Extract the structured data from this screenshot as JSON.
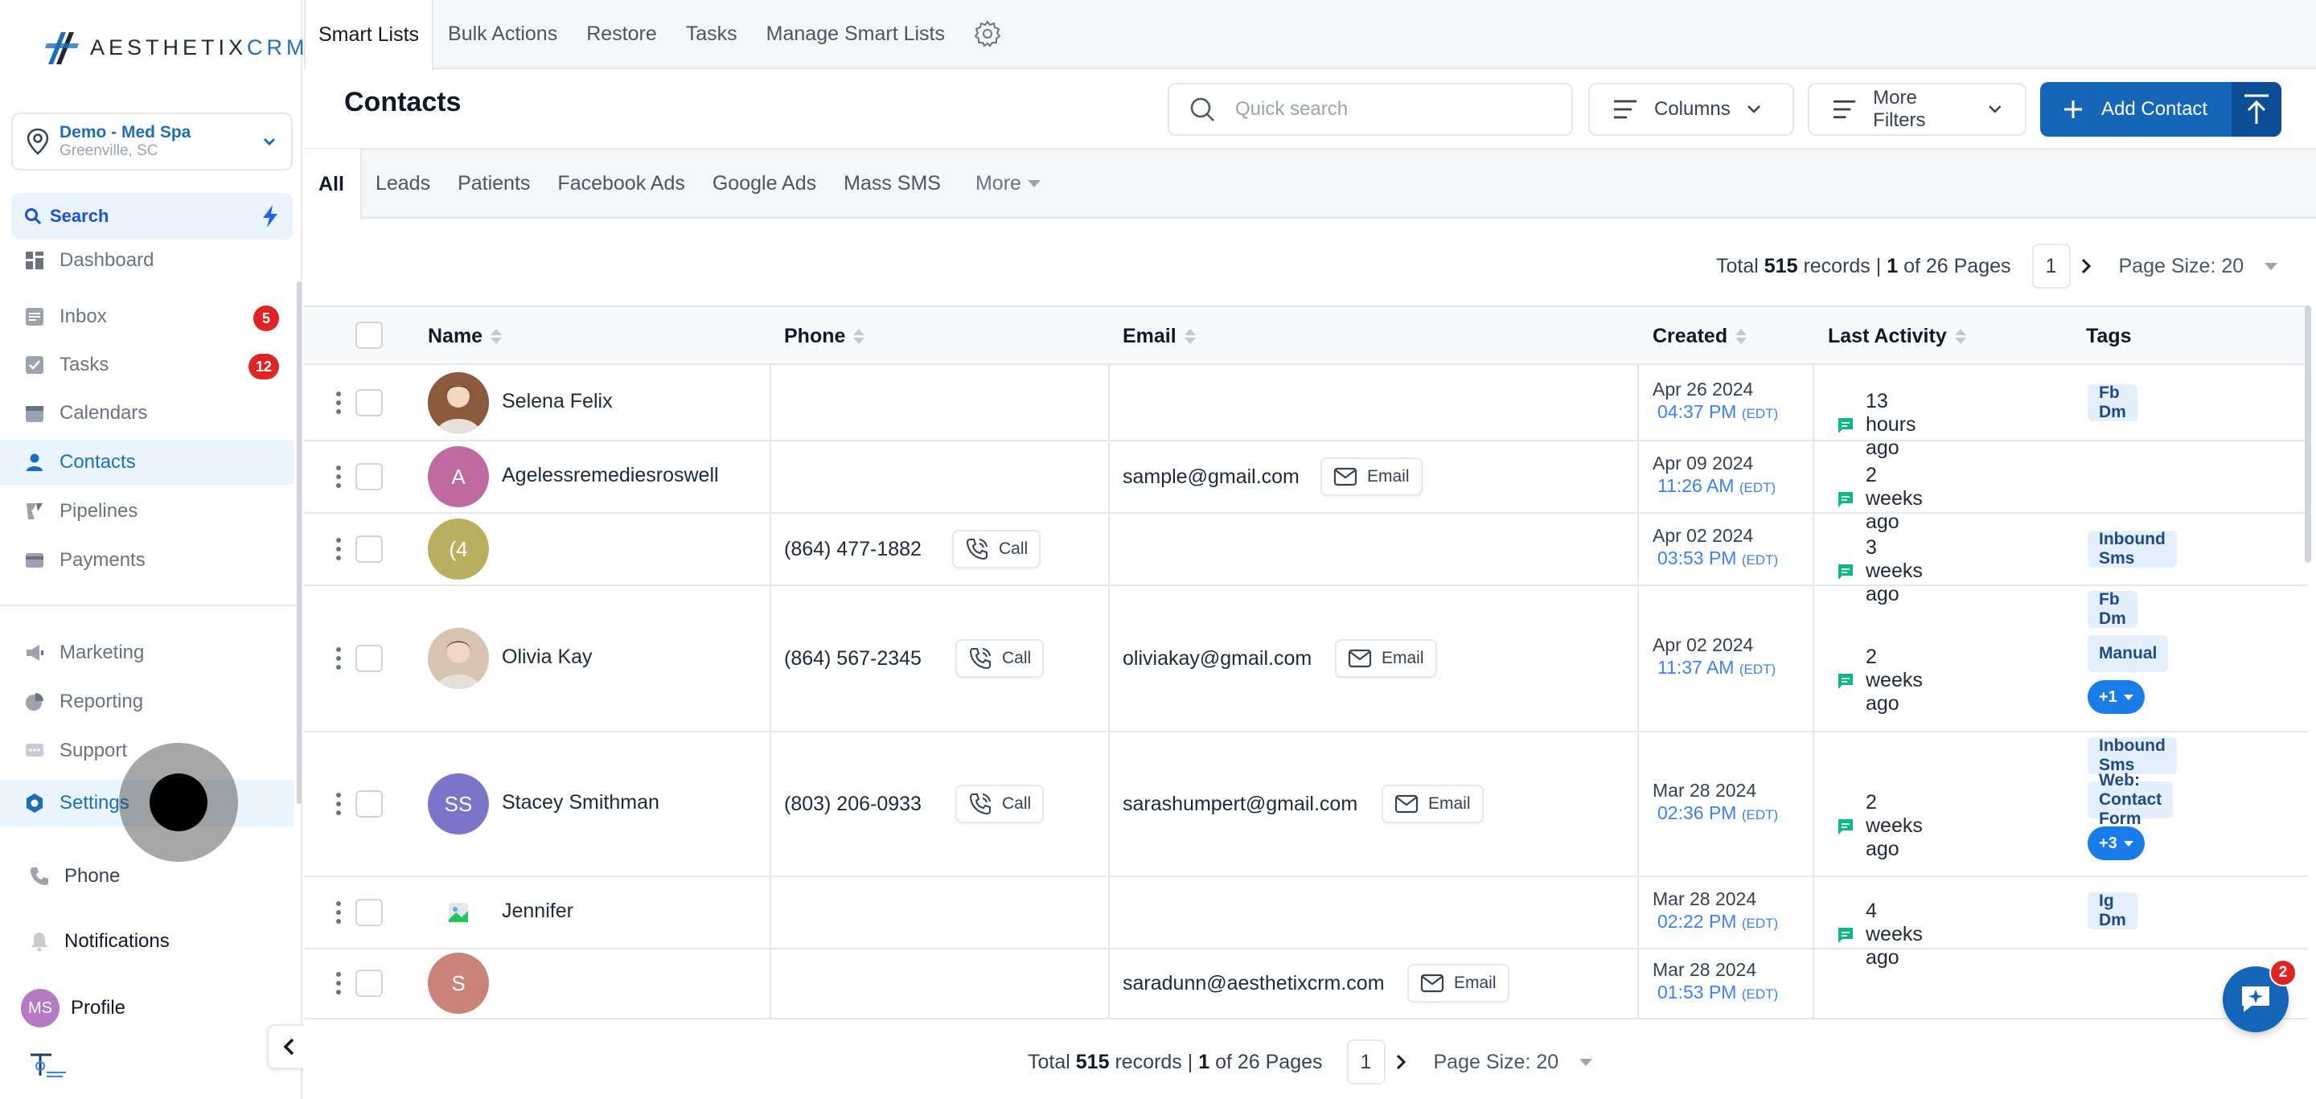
{
  "brand": {
    "logo_text_1": "AESTHETIX",
    "logo_text_2": "CRM",
    "accent": "#1565b8"
  },
  "location": {
    "name": "Demo - Med Spa",
    "city": "Greenville, SC"
  },
  "sidebar": {
    "search_label": "Search",
    "items": [
      {
        "label": "Dashboard",
        "icon": "dashboard-icon"
      },
      {
        "label": "Inbox",
        "icon": "inbox-icon",
        "badge": "5"
      },
      {
        "label": "Tasks",
        "icon": "tasks-icon",
        "badge": "12"
      },
      {
        "label": "Calendars",
        "icon": "calendar-icon"
      },
      {
        "label": "Contacts",
        "icon": "person-icon",
        "active": true
      },
      {
        "label": "Pipelines",
        "icon": "funnel-icon"
      },
      {
        "label": "Payments",
        "icon": "payments-icon"
      },
      {
        "label": "Marketing",
        "icon": "megaphone-icon"
      },
      {
        "label": "Reporting",
        "icon": "pie-chart-icon"
      },
      {
        "label": "Support",
        "icon": "chat-icon"
      },
      {
        "label": "Settings",
        "icon": "gear-icon"
      }
    ],
    "bottom": {
      "phone": "Phone",
      "notifications": "Notifications",
      "profile": "Profile",
      "profile_initials": "MS"
    }
  },
  "topnav": {
    "items": [
      "Smart Lists",
      "Bulk Actions",
      "Restore",
      "Tasks",
      "Manage Smart Lists"
    ]
  },
  "header": {
    "title": "Contacts",
    "search_placeholder": "Quick search",
    "columns_label": "Columns",
    "filters_label": "More Filters",
    "add_label": "Add Contact"
  },
  "tabs": [
    "All",
    "Leads",
    "Patients",
    "Facebook Ads",
    "Google Ads",
    "Mass SMS"
  ],
  "tabs_more": "More",
  "pagination": {
    "total_prefix": "Total",
    "total": "515",
    "records_text": "records |",
    "page": "1",
    "of_text": "of 26 Pages",
    "page_size": "Page Size: 20"
  },
  "table": {
    "headers": {
      "name": "Name",
      "phone": "Phone",
      "email": "Email",
      "created": "Created",
      "last_activity": "Last Activity",
      "tags": "Tags"
    },
    "call_label": "Call",
    "email_label": "Email",
    "rows": [
      {
        "name": "Selena Felix",
        "avatar": "photo",
        "avatar_color": "#8b5a3c",
        "phone": "",
        "email": "",
        "created_date": "Apr 26 2024",
        "created_time": "04:37 PM",
        "tz": "(EDT)",
        "activity": "13 hours ago",
        "tags": [
          "Fb Dm"
        ]
      },
      {
        "name": "Agelessremediesroswell",
        "avatar": "A",
        "avatar_color": "#c06aa4",
        "phone": "",
        "email": "sample@gmail.com",
        "created_date": "Apr 09 2024",
        "created_time": "11:26 AM",
        "tz": "(EDT)",
        "activity": "2 weeks ago",
        "tags": []
      },
      {
        "name": "",
        "avatar": "(4",
        "avatar_color": "#b9ad5e",
        "phone": "(864) 477-1882",
        "email": "",
        "created_date": "Apr 02 2024",
        "created_time": "03:53 PM",
        "tz": "(EDT)",
        "activity": "3 weeks ago",
        "tags": [
          "Inbound Sms"
        ]
      },
      {
        "name": "Olivia Kay",
        "avatar": "photo",
        "avatar_color": "#d8c4b0",
        "phone": "(864) 567-2345",
        "email": "oliviakay@gmail.com",
        "created_date": "Apr 02 2024",
        "created_time": "11:37 AM",
        "tz": "(EDT)",
        "activity": "2 weeks ago",
        "tags": [
          "Fb Dm",
          "Manual"
        ],
        "more": "+1"
      },
      {
        "name": "Stacey Smithman",
        "avatar": "SS",
        "avatar_color": "#7b75c9",
        "phone": "(803) 206-0933",
        "email": "sarashumpert@gmail.com",
        "created_date": "Mar 28 2024",
        "created_time": "02:36 PM",
        "tz": "(EDT)",
        "activity": "2 weeks ago",
        "tags": [
          "Inbound Sms",
          "Web: Contact Form"
        ],
        "more": "+3"
      },
      {
        "name": "Jennifer",
        "avatar": "img",
        "avatar_color": "#ffffff",
        "phone": "",
        "email": "",
        "created_date": "Mar 28 2024",
        "created_time": "02:22 PM",
        "tz": "(EDT)",
        "activity": "4 weeks ago",
        "tags": [
          "Ig Dm"
        ]
      },
      {
        "name": "",
        "avatar": "S",
        "avatar_color": "#c98378",
        "phone": "",
        "email": "saradunn@aesthetixcrm.com",
        "created_date": "Mar 28 2024",
        "created_time": "01:53 PM",
        "tz": "(EDT)",
        "activity": "",
        "tags": []
      }
    ]
  },
  "chat": {
    "badge": "2"
  }
}
